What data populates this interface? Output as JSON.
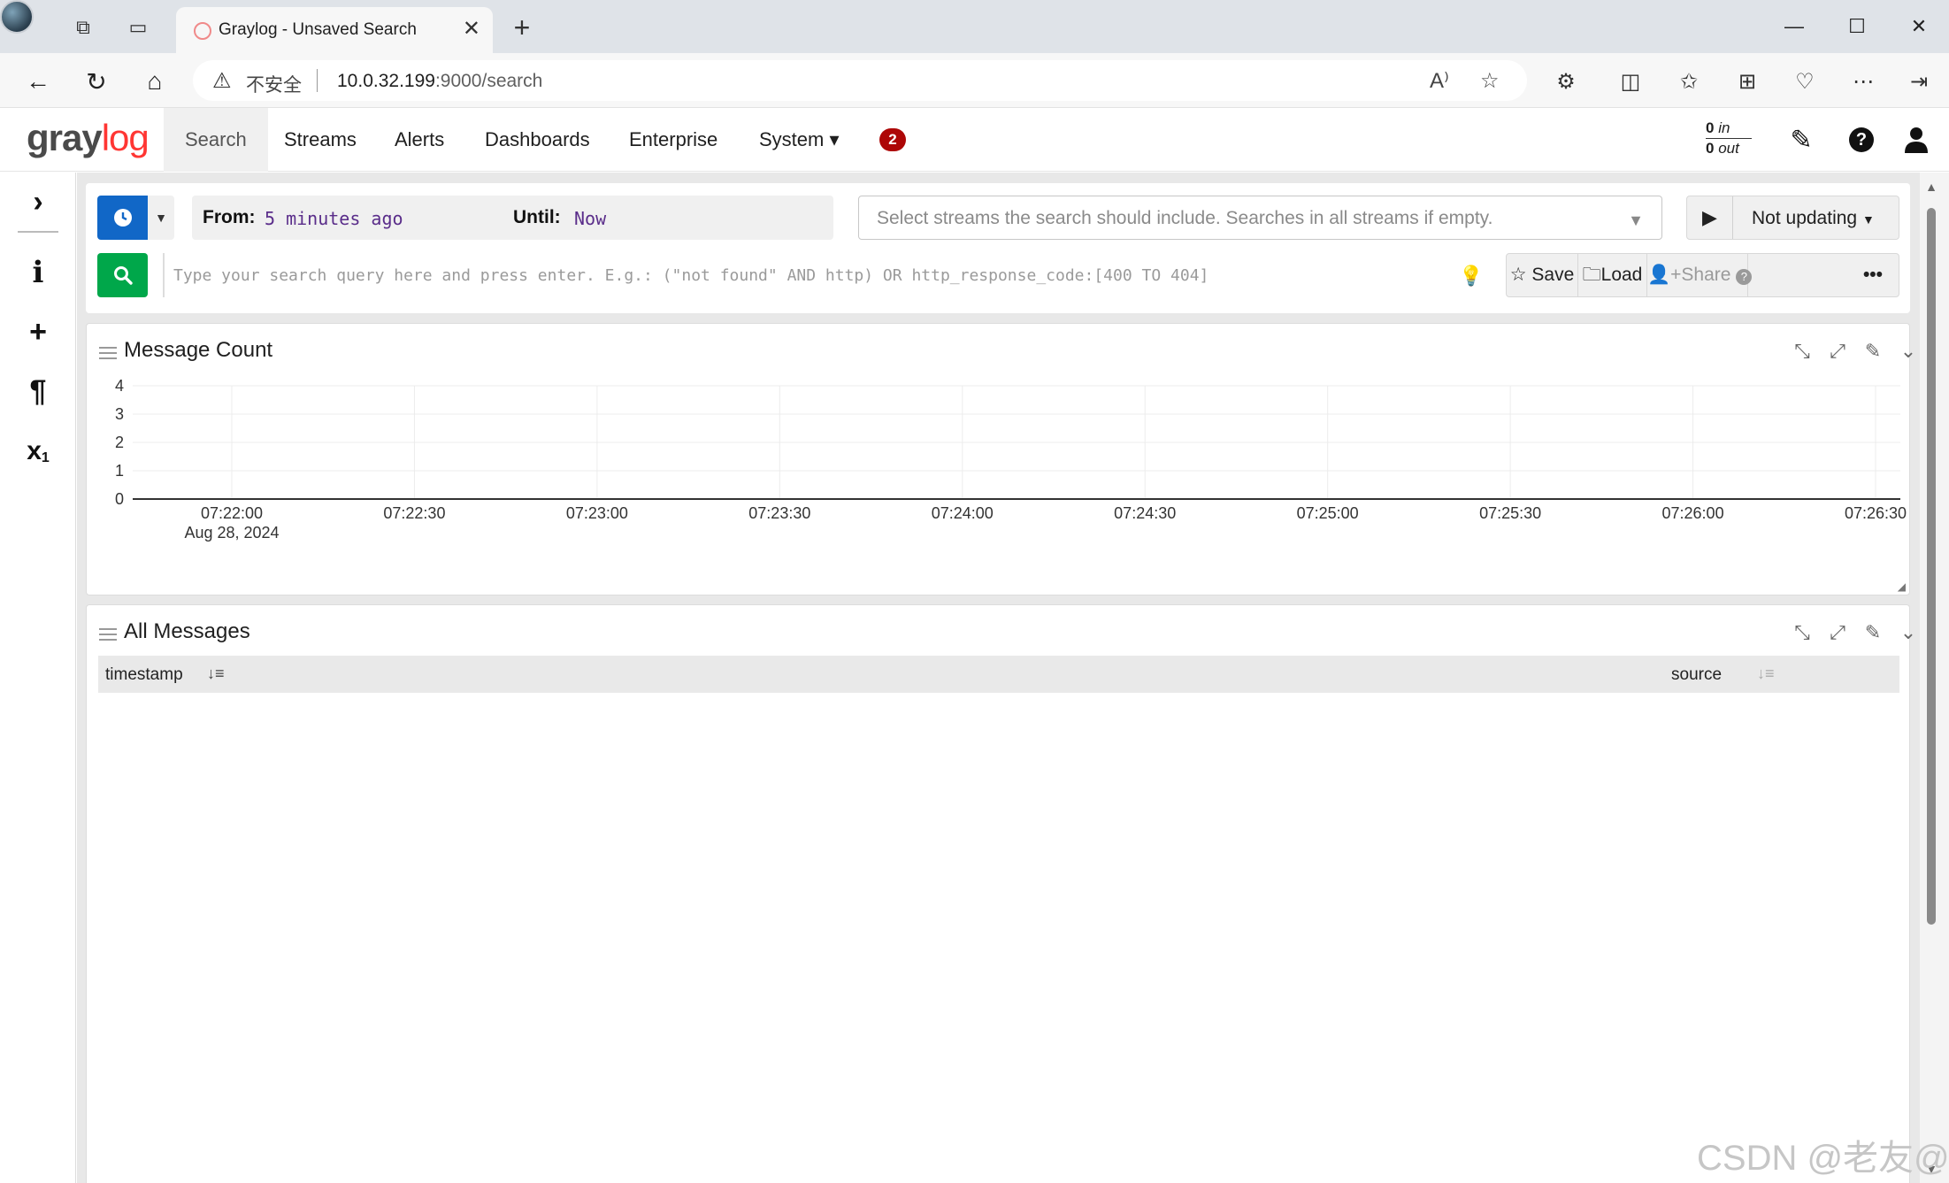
{
  "browser": {
    "tab_title": "Graylog - Unsaved Search",
    "security_label": "不安全",
    "url_host": "10.0.32.199",
    "url_path": ":9000/search"
  },
  "navbar": {
    "logo_gray": "gray",
    "logo_log": "log",
    "items": [
      "Search",
      "Streams",
      "Alerts",
      "Dashboards",
      "Enterprise",
      "System"
    ],
    "system_caret": "▾",
    "notification_count": "2",
    "throughput_in_value": "0",
    "throughput_in_label": "in",
    "throughput_out_value": "0",
    "throughput_out_label": "out"
  },
  "search_bar": {
    "from_label": "From:",
    "from_value": "5 minutes ago",
    "until_label": "Until:",
    "until_value": "Now",
    "streams_placeholder": "Select streams the search should include. Searches in all streams if empty.",
    "refresh_label": "Not updating",
    "query_placeholder": "Type your search query here and press enter. E.g.: (\"not found\" AND http) OR http_response_code:[400 TO 404]",
    "save_label": "Save",
    "load_label": "Load",
    "share_label": "Share"
  },
  "widgets": {
    "message_count": {
      "title": "Message Count"
    },
    "all_messages": {
      "title": "All Messages",
      "columns": [
        "timestamp",
        "source"
      ]
    }
  },
  "chart_data": {
    "type": "bar",
    "title": "Message Count",
    "x": [
      "07:22:00",
      "07:22:30",
      "07:23:00",
      "07:23:30",
      "07:24:00",
      "07:24:30",
      "07:25:00",
      "07:25:30",
      "07:26:00",
      "07:26:30"
    ],
    "x_sublabel": "Aug 28, 2024",
    "values": [
      0,
      0,
      0,
      0,
      0,
      0,
      0,
      0,
      0,
      0
    ],
    "yticks": [
      0,
      1,
      2,
      3,
      4
    ],
    "ylim": [
      0,
      4
    ],
    "grid": true
  },
  "watermark": "CSDN @老友@"
}
